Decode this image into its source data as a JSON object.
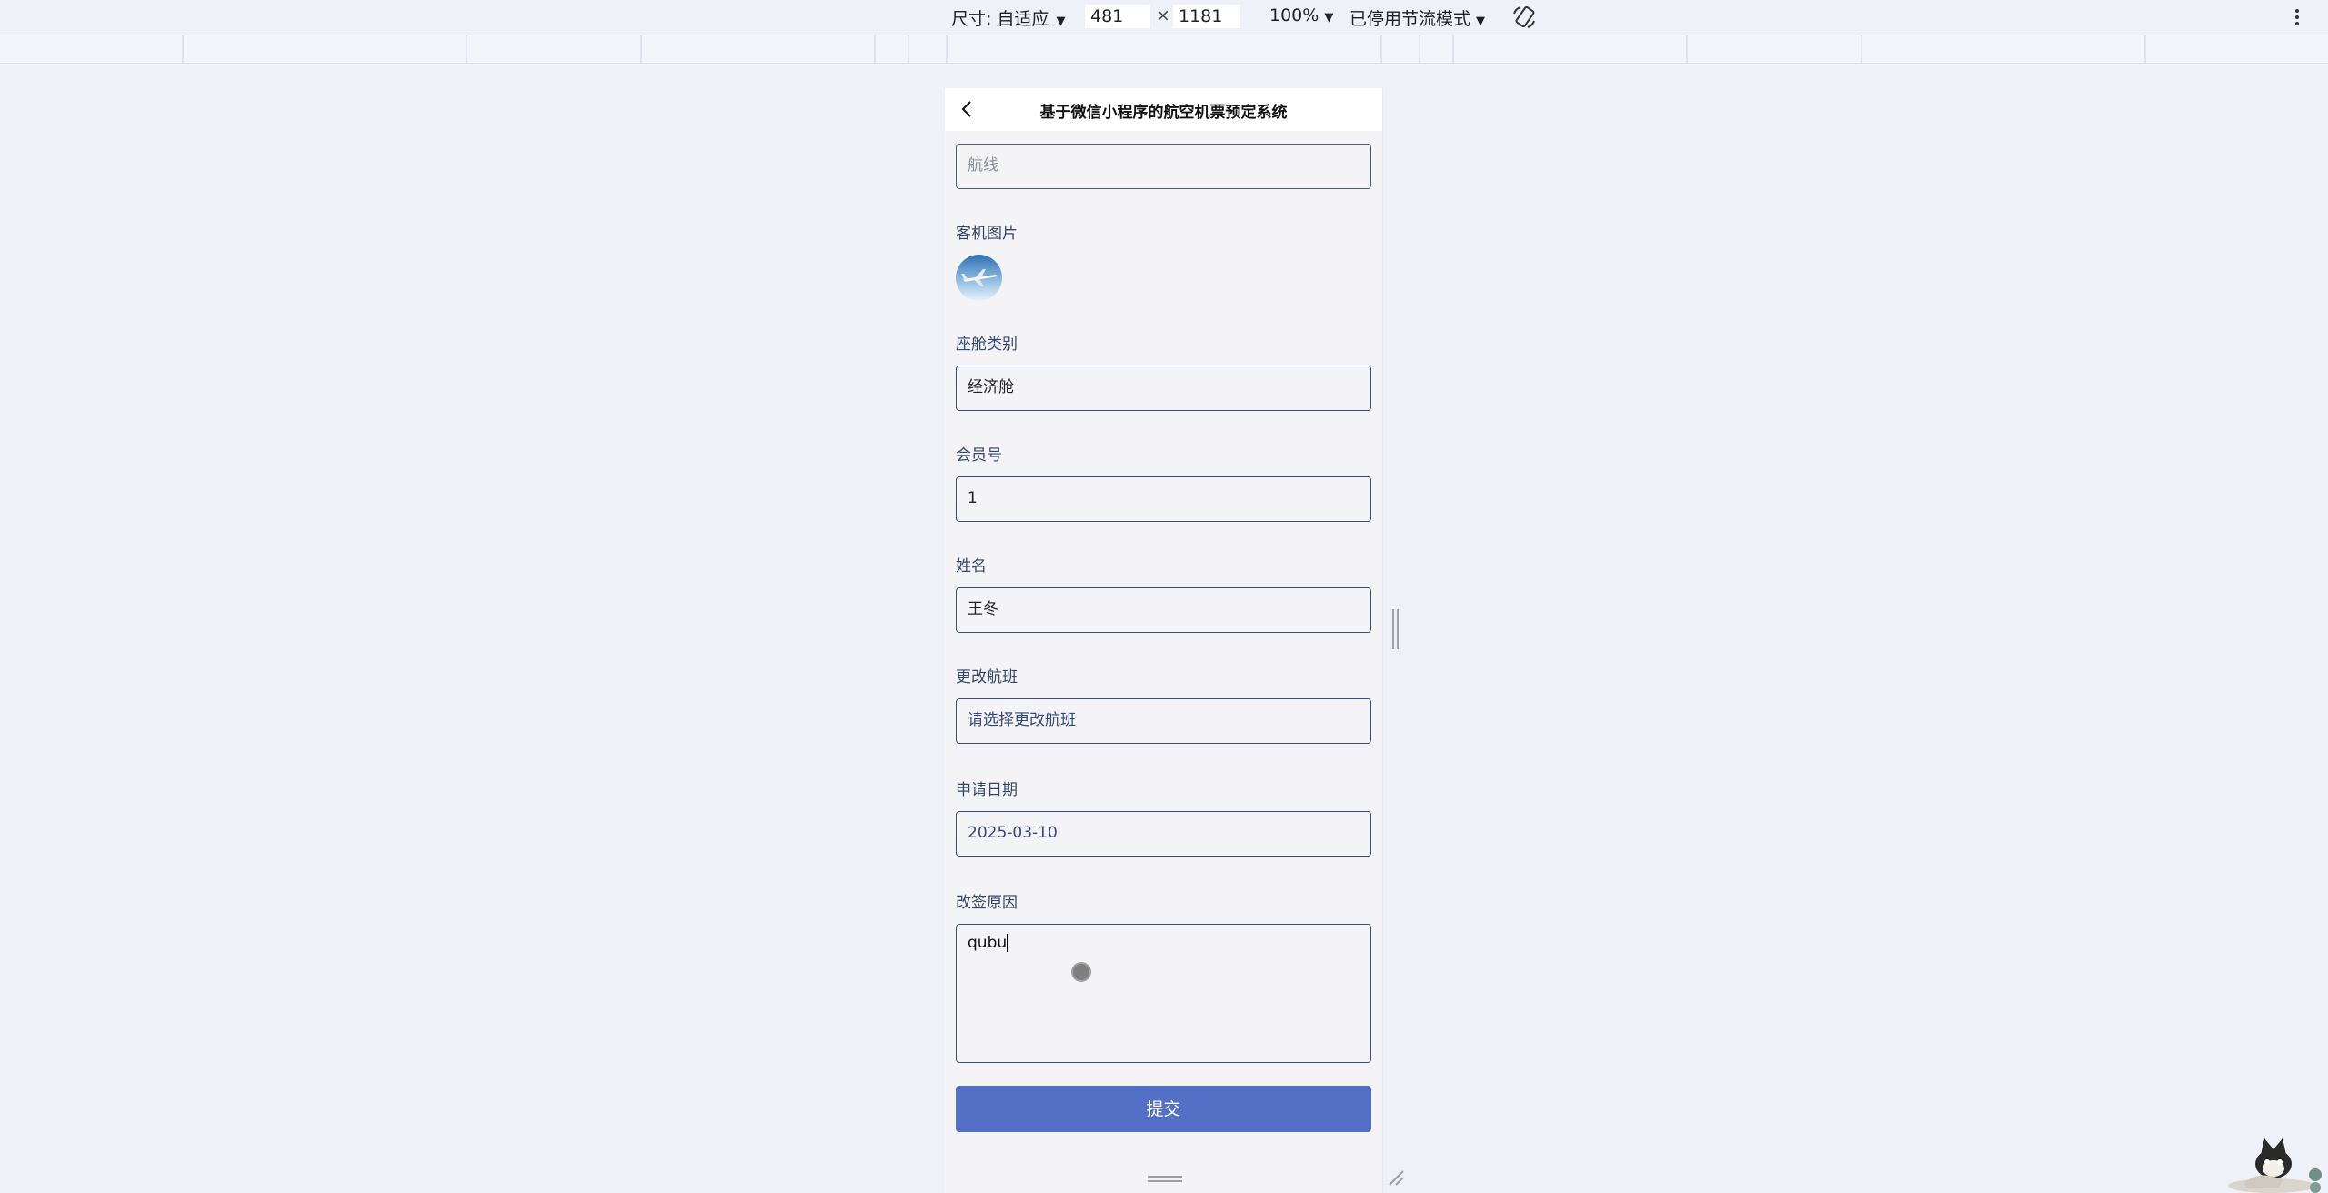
{
  "devtools": {
    "size_label": "尺寸: 自适应",
    "width": "481",
    "times": "×",
    "height": "1181",
    "zoom": "100%",
    "throttle": "已停用节流模式"
  },
  "app": {
    "title": "基于微信小程序的航空机票预定系统"
  },
  "form": {
    "route_placeholder": "航线",
    "plane_image_label": "客机图片",
    "cabin_label": "座舱类别",
    "cabin_value": "经济舱",
    "member_label": "会员号",
    "member_value": "1",
    "name_label": "姓名",
    "name_value": "王冬",
    "change_flight_label": "更改航班",
    "change_flight_placeholder": "请选择更改航班",
    "apply_date_label": "申请日期",
    "apply_date_value": "2025-03-10",
    "reason_label": "改签原因",
    "reason_value": "qubu",
    "submit_label": "提交"
  },
  "colors": {
    "accent": "#5470c6",
    "label": "#34466b",
    "border": "#3c4c7a",
    "page_bg": "#eef2f8"
  }
}
